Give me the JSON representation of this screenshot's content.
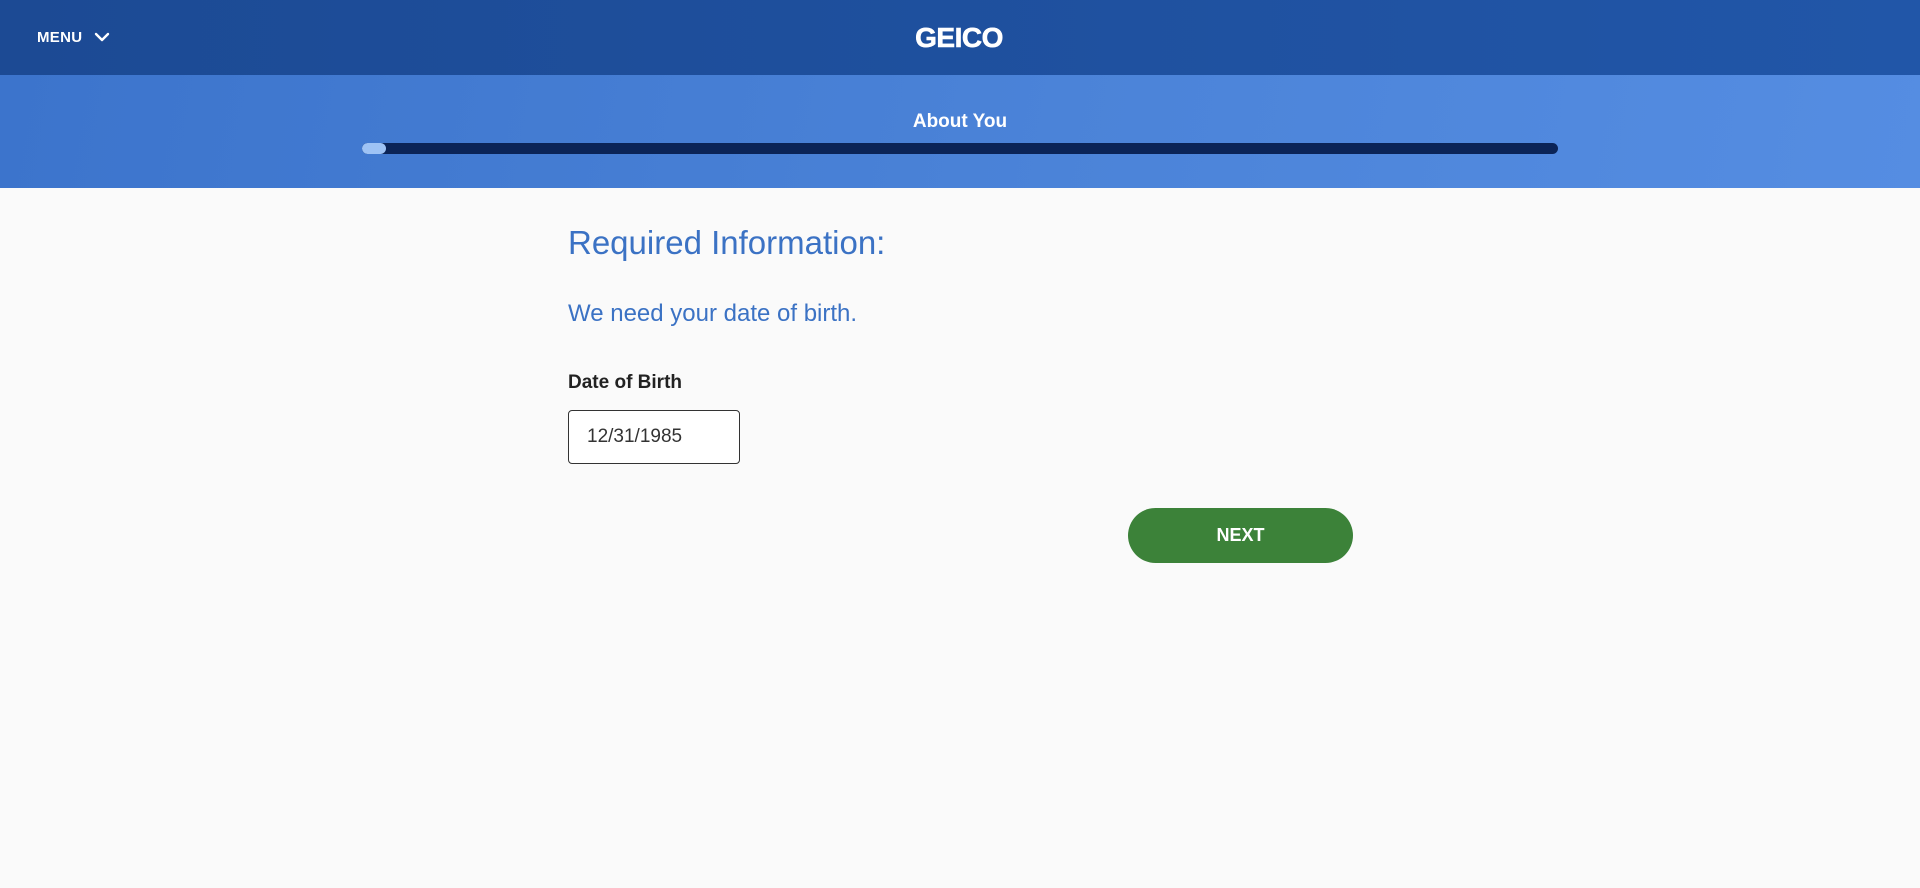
{
  "header": {
    "menu_label": "MENU",
    "menu_icon": "chevron-down-icon",
    "logo_text": "GEICO",
    "colors": {
      "nav_background": "#1c4a94",
      "logo": "#ffffff"
    }
  },
  "progress": {
    "title": "About You",
    "fraction": 0.02,
    "colors": {
      "track": "#0b2457",
      "fill": "#9ec3f5",
      "band": "#4b83d8"
    }
  },
  "form": {
    "heading": "Required Information:",
    "subheading": "We need your date of birth.",
    "dob_label": "Date of Birth",
    "dob_value": "12/31/1985",
    "next_label": "NEXT",
    "colors": {
      "heading": "#3b72c4",
      "next_button": "#3c8239"
    }
  }
}
